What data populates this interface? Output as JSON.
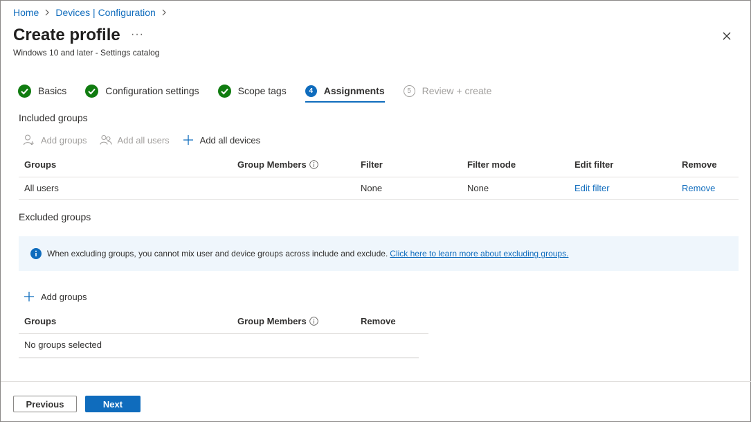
{
  "breadcrumb": {
    "home": "Home",
    "devices": "Devices | Configuration"
  },
  "header": {
    "title": "Create profile",
    "more": "···",
    "subtitle": "Windows 10 and later - Settings catalog"
  },
  "steps": [
    {
      "label": "Basics",
      "state": "complete"
    },
    {
      "label": "Configuration settings",
      "state": "complete"
    },
    {
      "label": "Scope tags",
      "state": "complete"
    },
    {
      "label": "Assignments",
      "number": "4",
      "state": "active"
    },
    {
      "label": "Review + create",
      "number": "5",
      "state": "disabled"
    }
  ],
  "included": {
    "label": "Included groups",
    "commands": {
      "add_groups": "Add groups",
      "add_all_users": "Add all users",
      "add_all_devices": "Add all devices"
    },
    "headers": [
      "Groups",
      "Group Members",
      "Filter",
      "Filter mode",
      "Edit filter",
      "Remove"
    ],
    "rows": [
      {
        "group": "All users",
        "members": "",
        "filter": "None",
        "filter_mode": "None",
        "edit_filter": "Edit filter",
        "remove": "Remove"
      }
    ]
  },
  "excluded": {
    "label": "Excluded groups",
    "banner_text": "When excluding groups, you cannot mix user and device groups across include and exclude.",
    "banner_link": "Click here to learn more about excluding groups.",
    "add_groups": "Add groups",
    "headers": [
      "Groups",
      "Group Members",
      "Remove"
    ],
    "empty": "No groups selected"
  },
  "footer": {
    "previous": "Previous",
    "next": "Next"
  },
  "colors": {
    "accent": "#0f6cbd",
    "success": "#107c10",
    "banner_bg": "#eff6fc"
  }
}
